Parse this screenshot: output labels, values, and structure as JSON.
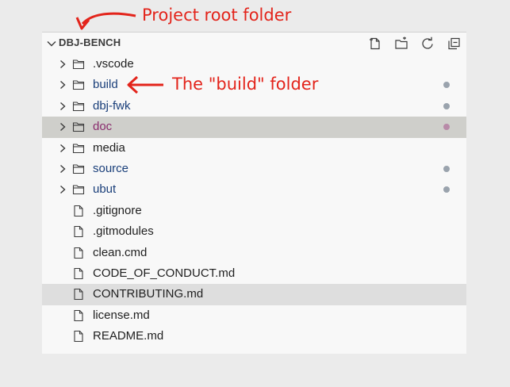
{
  "explorer": {
    "root_title": "DBJ-BENCH",
    "actions": [
      {
        "name": "new-file-icon"
      },
      {
        "name": "new-folder-icon"
      },
      {
        "name": "refresh-icon"
      },
      {
        "name": "collapse-all-icon"
      }
    ],
    "items": [
      {
        "label": "vscode",
        "display": ".vscode",
        "type": "folder",
        "color": "#1f1f1f",
        "dot": null
      },
      {
        "label": "build",
        "display": "build",
        "type": "folder",
        "color": "#1a3f7a",
        "dot": "#9aa3ad"
      },
      {
        "label": "dbj-fwk",
        "display": "dbj-fwk",
        "type": "folder",
        "color": "#1a3f7a",
        "dot": "#9aa3ad"
      },
      {
        "label": "doc",
        "display": "doc",
        "type": "folder",
        "color": "#8a2d6e",
        "dot": "#b88aa8",
        "selected": true
      },
      {
        "label": "media",
        "display": "media",
        "type": "folder",
        "color": "#1f1f1f",
        "dot": null
      },
      {
        "label": "source",
        "display": "source",
        "type": "folder",
        "color": "#1a3f7a",
        "dot": "#9aa3ad"
      },
      {
        "label": "ubut",
        "display": "ubut",
        "type": "folder",
        "color": "#1a3f7a",
        "dot": "#9aa3ad"
      },
      {
        "label": "gitignore",
        "display": ".gitignore",
        "type": "file",
        "color": "#1f1f1f",
        "dot": null
      },
      {
        "label": "gitmodules",
        "display": ".gitmodules",
        "type": "file",
        "color": "#1f1f1f",
        "dot": null
      },
      {
        "label": "clean-cmd",
        "display": "clean.cmd",
        "type": "file",
        "color": "#1f1f1f",
        "dot": null
      },
      {
        "label": "code-of-conduct",
        "display": "CODE_OF_CONDUCT.md",
        "type": "file",
        "color": "#1f1f1f",
        "dot": null
      },
      {
        "label": "contributing",
        "display": "CONTRIBUTING.md",
        "type": "file",
        "color": "#1f1f1f",
        "dot": null,
        "hover": true
      },
      {
        "label": "license",
        "display": "license.md",
        "type": "file",
        "color": "#1f1f1f",
        "dot": null
      },
      {
        "label": "readme",
        "display": "README.md",
        "type": "file",
        "color": "#1f1f1f",
        "dot": null
      }
    ]
  },
  "annotations": {
    "root": "Project root folder",
    "build": "The \"build\" folder",
    "color": "#e3241b"
  }
}
